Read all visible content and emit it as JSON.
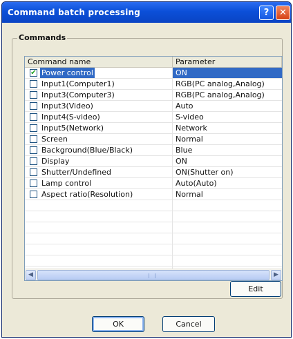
{
  "window": {
    "title": "Command batch processing",
    "help_label": "?",
    "close_label": "✕"
  },
  "group": {
    "label": "Commands"
  },
  "table": {
    "columns": [
      "Command name",
      "Parameter"
    ],
    "rows": [
      {
        "name": "Power control",
        "param": "ON",
        "checked": true,
        "selected": true
      },
      {
        "name": "Input1(Computer1)",
        "param": "RGB(PC analog,Analog)",
        "checked": false,
        "selected": false
      },
      {
        "name": "Input3(Computer3)",
        "param": "RGB(PC analog,Analog)",
        "checked": false,
        "selected": false
      },
      {
        "name": "Input3(Video)",
        "param": "Auto",
        "checked": false,
        "selected": false
      },
      {
        "name": "Input4(S-video)",
        "param": "S-video",
        "checked": false,
        "selected": false
      },
      {
        "name": "Input5(Network)",
        "param": "Network",
        "checked": false,
        "selected": false
      },
      {
        "name": "Screen",
        "param": "Normal",
        "checked": false,
        "selected": false
      },
      {
        "name": "Background(Blue/Black)",
        "param": "Blue",
        "checked": false,
        "selected": false
      },
      {
        "name": "Display",
        "param": "ON",
        "checked": false,
        "selected": false
      },
      {
        "name": "Shutter/Undefined",
        "param": "ON(Shutter on)",
        "checked": false,
        "selected": false
      },
      {
        "name": "Lamp control",
        "param": "Auto(Auto)",
        "checked": false,
        "selected": false
      },
      {
        "name": "Aspect ratio(Resolution)",
        "param": "Normal",
        "checked": false,
        "selected": false
      }
    ],
    "empty_rows": 7
  },
  "scrollbar": {
    "left_icon": "◀",
    "right_icon": "▶"
  },
  "buttons": {
    "edit": "Edit",
    "ok": "OK",
    "cancel": "Cancel"
  },
  "colors": {
    "title_bar": "#0b4fd8",
    "selection": "#316ac5",
    "checkmark": "#21a121"
  }
}
